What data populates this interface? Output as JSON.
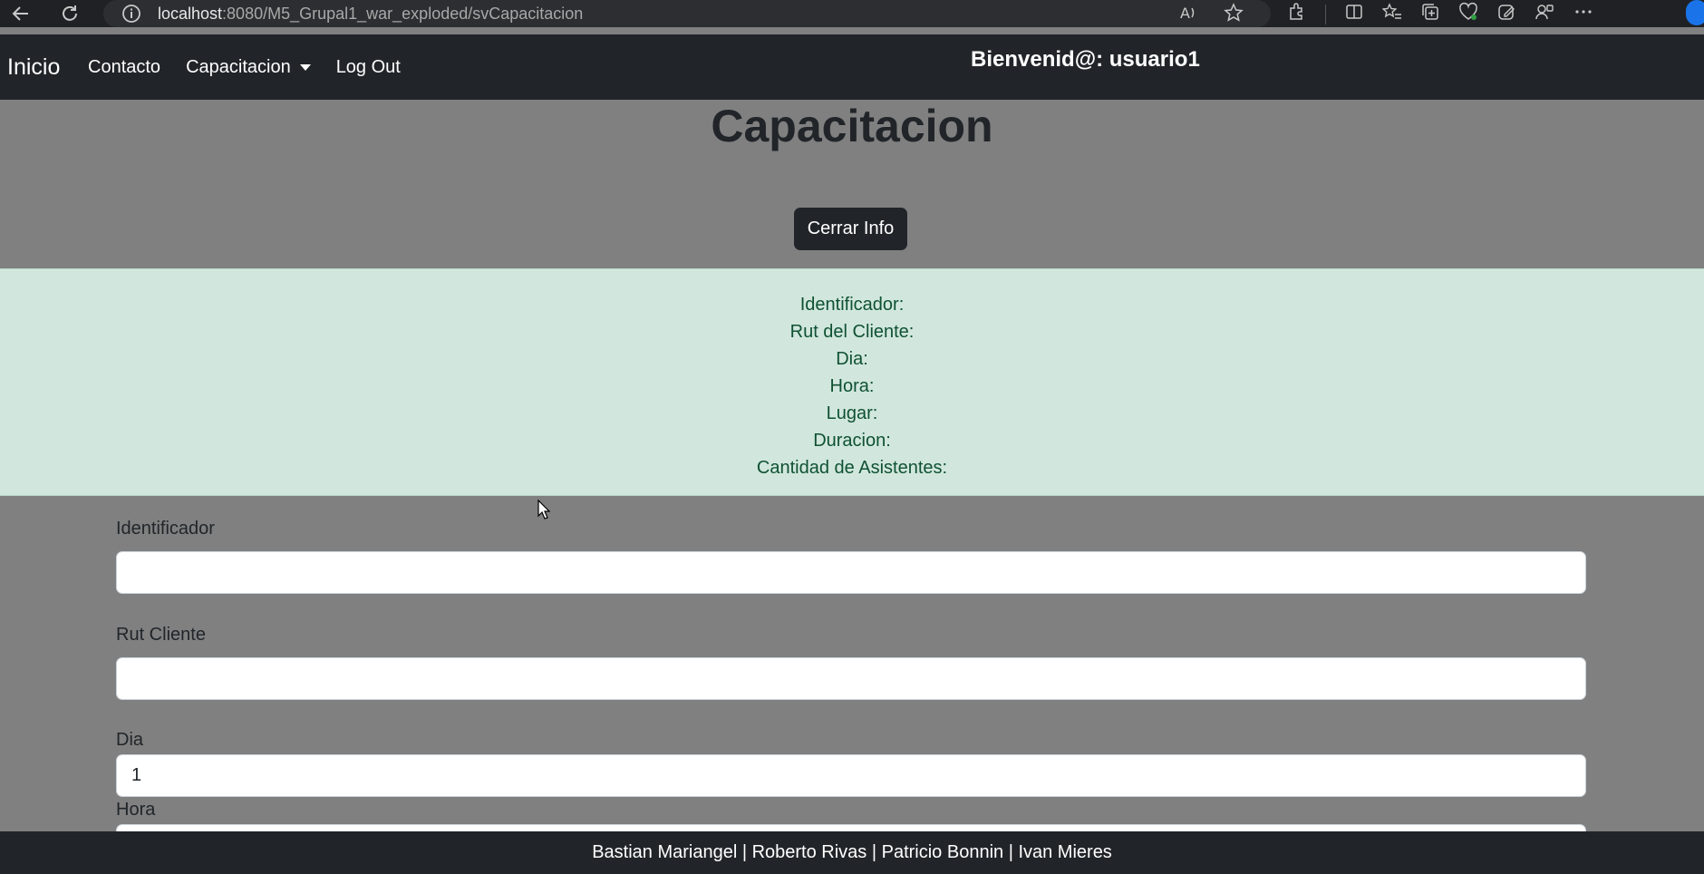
{
  "browser": {
    "url_host": "localhost",
    "url_path": ":8080/M5_Grupal1_war_exploded/svCapacitacion"
  },
  "navbar": {
    "brand": "Inicio",
    "links": [
      "Contacto",
      "Capacitacion",
      "Log Out"
    ],
    "welcome": "Bienvenid@: usuario1"
  },
  "main": {
    "title": "Capacitacion",
    "close_button": "Cerrar Info",
    "info_lines": [
      "Identificador:",
      "Rut del Cliente:",
      "Dia:",
      "Hora:",
      "Lugar:",
      "Duracion:",
      "Cantidad de Asistentes:"
    ]
  },
  "form": {
    "identificador_label": "Identificador",
    "identificador_value": "",
    "rut_label": "Rut Cliente",
    "rut_value": "",
    "dia_label": "Dia",
    "dia_value": "1",
    "hora_label": "Hora",
    "hora_value": ""
  },
  "footer": {
    "text": "Bastian Mariangel | Roberto Rivas | Patricio Bonnin | Ivan Mieres"
  },
  "colors": {
    "navbar": "#212529",
    "page_bg": "#808080",
    "info_bg": "#d1e7dd",
    "info_text": "#0f5132"
  }
}
